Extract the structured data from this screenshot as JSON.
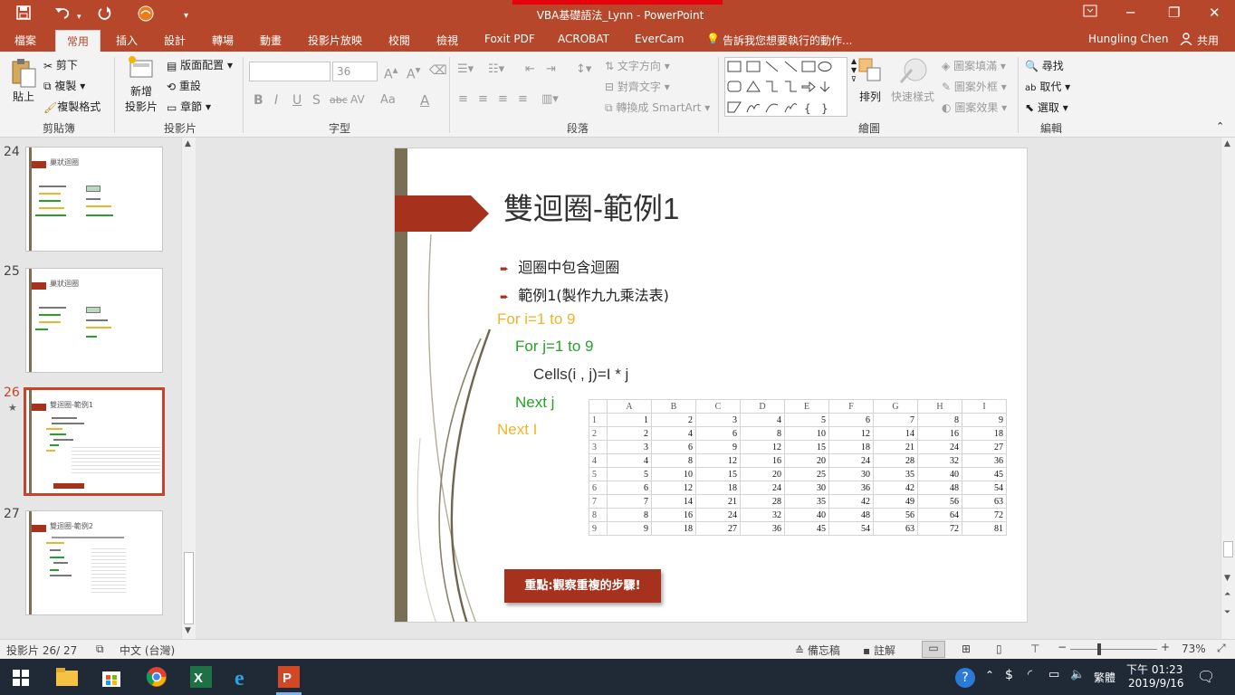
{
  "window": {
    "title": "VBA基礎語法_Lynn - PowerPoint"
  },
  "tabs": [
    "檔案",
    "常用",
    "插入",
    "設計",
    "轉場",
    "動畫",
    "投影片放映",
    "校閱",
    "檢視",
    "Foxit PDF",
    "ACROBAT",
    "EverCam"
  ],
  "tell_me": "告訴我您想要執行的動作...",
  "user": "Hungling Chen",
  "share": "共用",
  "ribbon": {
    "clipboard": {
      "paste": "貼上",
      "cut": "剪下",
      "copy": "複製",
      "format_painter": "複製格式",
      "name": "剪貼簿"
    },
    "slides": {
      "new_slide_l1": "新增",
      "new_slide_l2": "投影片",
      "layout": "版面配置",
      "reset": "重設",
      "section": "章節",
      "name": "投影片"
    },
    "font": {
      "size": "36",
      "name": "字型",
      "bold": "B",
      "italic": "I",
      "underline": "U",
      "shadow": "S",
      "strike": "abc",
      "spacing": "AV",
      "case": "Aa"
    },
    "paragraph": {
      "text_direction": "文字方向",
      "align_text": "對齊文字",
      "smartart": "轉換成 SmartArt",
      "name": "段落"
    },
    "drawing": {
      "arrange": "排列",
      "quick_styles": "快速樣式",
      "shape_fill": "圖案填滿",
      "shape_outline": "圖案外框",
      "shape_effects": "圖案效果",
      "name": "繪圖"
    },
    "editing": {
      "find": "尋找",
      "replace": "取代",
      "select": "選取",
      "name": "編輯"
    }
  },
  "thumbnails": [
    {
      "num": "24",
      "title": "巢狀迴圈"
    },
    {
      "num": "25",
      "title": "巢狀迴圈"
    },
    {
      "num": "26",
      "title": "雙迴圈-範例1",
      "star": "★"
    },
    {
      "num": "27",
      "title": "雙迴圈-範例2"
    }
  ],
  "slide": {
    "title": "雙迴圈-範例1",
    "bullets": [
      "迴圈中包含迴圈",
      "範例1(製作九九乘法表)"
    ],
    "code": {
      "line1": "For i=1 to 9",
      "line2": "For j=1 to 9",
      "line3": "Cells(i , j)=I * j",
      "line4": "Next j",
      "line5": "Next I"
    },
    "callout": "重點:觀察重複的步驟!",
    "colors": {
      "orange": "#f0b429",
      "green": "#27a12a",
      "accent": "#a6321d",
      "bar": "#7a6e55"
    }
  },
  "sheet": {
    "columns": [
      "A",
      "B",
      "C",
      "D",
      "E",
      "F",
      "G",
      "H",
      "I"
    ],
    "rows": [
      [
        "1",
        "1",
        "2",
        "3",
        "4",
        "5",
        "6",
        "7",
        "8",
        "9"
      ],
      [
        "2",
        "2",
        "4",
        "6",
        "8",
        "10",
        "12",
        "14",
        "16",
        "18"
      ],
      [
        "3",
        "3",
        "6",
        "9",
        "12",
        "15",
        "18",
        "21",
        "24",
        "27"
      ],
      [
        "4",
        "4",
        "8",
        "12",
        "16",
        "20",
        "24",
        "28",
        "32",
        "36"
      ],
      [
        "5",
        "5",
        "10",
        "15",
        "20",
        "25",
        "30",
        "35",
        "40",
        "45"
      ],
      [
        "6",
        "6",
        "12",
        "18",
        "24",
        "30",
        "36",
        "42",
        "48",
        "54"
      ],
      [
        "7",
        "7",
        "14",
        "21",
        "28",
        "35",
        "42",
        "49",
        "56",
        "63"
      ],
      [
        "8",
        "8",
        "16",
        "24",
        "32",
        "40",
        "48",
        "56",
        "64",
        "72"
      ],
      [
        "9",
        "9",
        "18",
        "27",
        "36",
        "45",
        "54",
        "63",
        "72",
        "81"
      ]
    ]
  },
  "status": {
    "slide_pos": "投影片 26/ 27",
    "language": "中文 (台灣)",
    "notes": "備忘稿",
    "comments": "註解",
    "zoom": "73%"
  },
  "taskbar": {
    "ime": "繁體",
    "time": "下午 01:23",
    "date": "2019/9/16"
  }
}
